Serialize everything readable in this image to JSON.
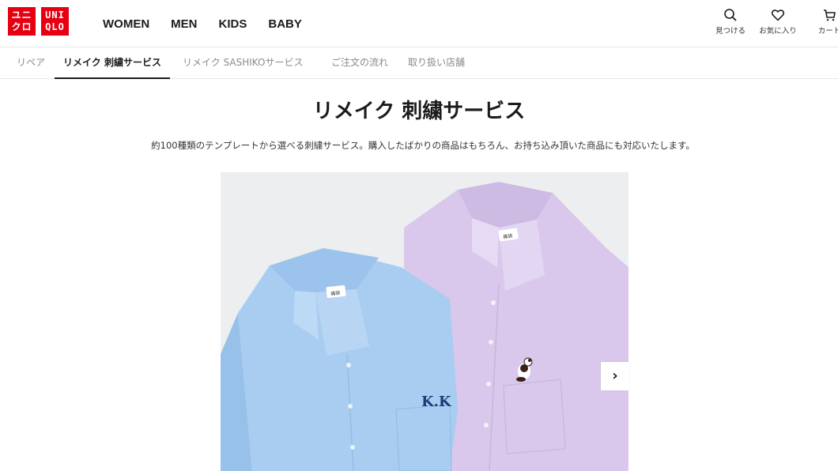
{
  "logo": {
    "box1_line1": "ユニ",
    "box1_line2": "クロ",
    "box2_line1": "UNI",
    "box2_line2": "QLO",
    "color": "#e60012"
  },
  "gender_nav": [
    "WOMEN",
    "MEN",
    "KIDS",
    "BABY"
  ],
  "utility": {
    "search_label": "見つける",
    "favorites_label": "お気に入り",
    "cart_label": "カート"
  },
  "subnav": {
    "tabs": [
      {
        "label": "リペア",
        "active": false
      },
      {
        "label": "リメイク 刺繍サービス",
        "active": true
      },
      {
        "label": "リメイク SASHIKOサービス",
        "active": false
      },
      {
        "label": "ご注文の流れ",
        "active": false
      },
      {
        "label": "取り扱い店舗",
        "active": false
      }
    ]
  },
  "main": {
    "title": "リメイク 刺繍サービス",
    "description": "約100種類のテンプレートから選べる刺繍サービス。購入したばかりの商品はもちろん、お持ち込み頂いた商品にも対応いたします。"
  },
  "carousel": {
    "embroidery_text": "K.K",
    "shirt_tag_text": "痛袋",
    "next_icon": "chevron-right-icon",
    "colors": {
      "blue_shirt": "#a9cdf0",
      "lavender_shirt": "#d9c8ec",
      "embroidery": "#1e3a78"
    }
  }
}
